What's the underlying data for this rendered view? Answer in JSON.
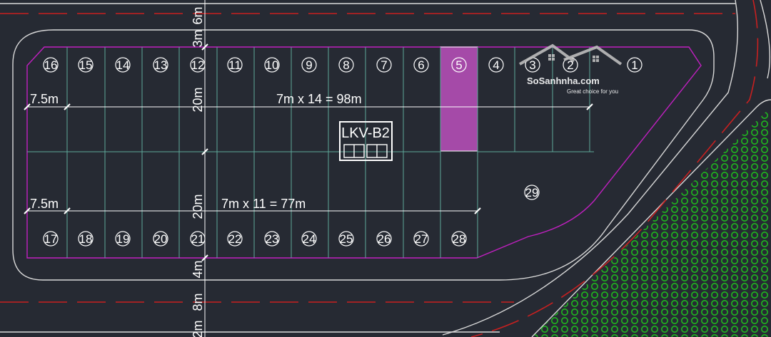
{
  "block_label": "LKV-B2",
  "highlighted_lot": "5",
  "colors": {
    "background": "#262a33",
    "road_edge": "#d9d9d9",
    "lot_line": "#5fa89a",
    "block_outline": "#c020c0",
    "highlight": "#a54aa8",
    "center_line": "#c82020",
    "green_area": "#1fb81f"
  },
  "top_row_lots": [
    "16",
    "15",
    "14",
    "13",
    "12",
    "11",
    "10",
    "9",
    "8",
    "7",
    "6",
    "5",
    "4",
    "3",
    "2",
    "1"
  ],
  "bottom_row_lots": [
    "17",
    "18",
    "19",
    "20",
    "21",
    "22",
    "23",
    "24",
    "25",
    "26",
    "27",
    "28"
  ],
  "corner_lot": "29",
  "dimensions": {
    "top_width": "7m x 14 = 98m",
    "bottom_width": "7m x 11 = 77m",
    "left_top": "7.5m",
    "left_bottom": "7.5m",
    "depth_top": "20m",
    "depth_bottom": "20m",
    "vertical_labels": [
      "6m",
      "3m",
      "4m",
      "8m",
      "2m"
    ]
  },
  "watermark": {
    "name": "SoSanhnha.com",
    "tagline": "Great choice for you"
  }
}
